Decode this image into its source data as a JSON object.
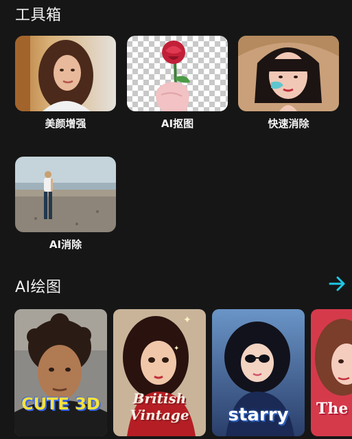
{
  "toolbox": {
    "title": "工具箱",
    "tools": [
      {
        "label": "美颜增强",
        "icon": "portrait-woman-image"
      },
      {
        "label": "AI抠图",
        "icon": "rose-cutout-image"
      },
      {
        "label": "快速消除",
        "icon": "bob-hair-woman-image"
      },
      {
        "label": "AI消除",
        "icon": "beach-woman-image"
      }
    ]
  },
  "ai_drawing": {
    "title": "AI绘图",
    "more_icon": "arrow-right-icon",
    "accent_color": "#1ec8e6",
    "cards": [
      {
        "caption": "CUTE 3D",
        "style": "cute-3d-boy"
      },
      {
        "caption": "British Vintage",
        "style": "british-vintage-girl"
      },
      {
        "caption": "starry",
        "style": "starry-anime-girl"
      },
      {
        "caption": "The coo",
        "style": "cool-pink-girl"
      }
    ]
  }
}
